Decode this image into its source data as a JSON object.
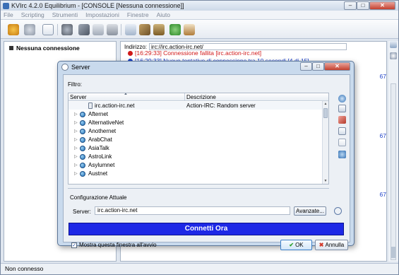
{
  "window": {
    "title": "KVIrc 4.2.0 Equilibrium - [CONSOLE [Nessuna connessione]]",
    "controls": [
      "–",
      "□",
      "✕"
    ]
  },
  "menu": [
    "File",
    "Scripting",
    "Strumenti",
    "Impostazioni",
    "Finestre",
    "Aiuto"
  ],
  "toolbar_icons": [
    "connect-icon",
    "user-icon",
    "window-icon",
    "settings-icon",
    "tools-icon",
    "script-icon",
    "print-icon",
    "message-icon",
    "network-icon",
    "options-icon",
    "mail-icon",
    "help-icon",
    "home-icon"
  ],
  "left_panel": {
    "header": "Nessuna connessione"
  },
  "console": {
    "address_label": "Indirizzo:",
    "address_value": "irc://irc.action-irc.net/",
    "lines": [
      {
        "text": "[16:29:33] Connessione fallita [irc.action-irc.net]",
        "color": "#d01818"
      },
      {
        "text": "[16:29:33] Nuovo tentativo di connessione tra 10 secondi [4 di 15]",
        "color": "#1d42c9"
      }
    ],
    "side_numbers": [
      "67",
      "67",
      "67"
    ]
  },
  "status": {
    "text": "Non connesso"
  },
  "dialog": {
    "title": "Server",
    "filter_label": "Filtro:",
    "filter_value": "",
    "columns": [
      "Server",
      "Descrizione"
    ],
    "rows": [
      {
        "name": "irc.action-irc.net",
        "desc": "Action-IRC: Random server",
        "selected": true,
        "child": true
      },
      {
        "name": "Afternet",
        "desc": ""
      },
      {
        "name": "AlternativeNet",
        "desc": ""
      },
      {
        "name": "Anothernet",
        "desc": ""
      },
      {
        "name": "ArabChat",
        "desc": ""
      },
      {
        "name": "AsiaTalk",
        "desc": ""
      },
      {
        "name": "AstroLink",
        "desc": ""
      },
      {
        "name": "Asylumnet",
        "desc": ""
      },
      {
        "name": "Austnet",
        "desc": ""
      }
    ],
    "current_config_label": "Configurazione Attuale",
    "server_label": "Server:",
    "server_value": "irc.action-irc.net",
    "advanced_button": "Avanzate...",
    "connect_button": "Connetti Ora",
    "show_on_startup_label": "Mostra questa finestra all'avvio",
    "show_on_startup_checked": true,
    "ok_button": "OK",
    "cancel_button": "Annulla"
  },
  "colors": {
    "connect_bg": "#1d28e6",
    "error_text": "#d01818",
    "info_text": "#1d42c9"
  }
}
